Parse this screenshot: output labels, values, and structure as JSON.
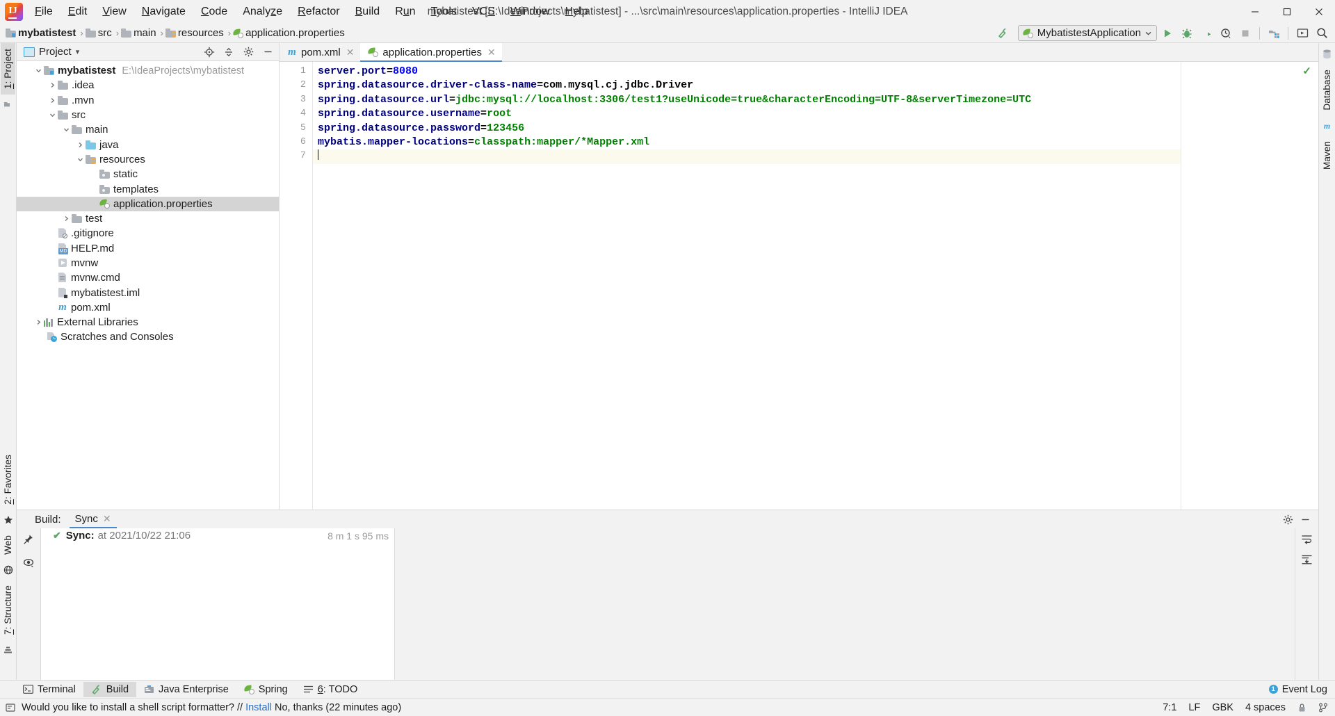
{
  "window": {
    "title": "mybatistest [E:\\IdeaProjects\\mybatistest] - ...\\src\\main\\resources\\application.properties - IntelliJ IDEA",
    "minimize_label": "—",
    "maximize_label": "❐",
    "close_label": "✕"
  },
  "menubar": {
    "items": [
      {
        "pre": "",
        "mn": "F",
        "post": "ile"
      },
      {
        "pre": "",
        "mn": "E",
        "post": "dit"
      },
      {
        "pre": "",
        "mn": "V",
        "post": "iew"
      },
      {
        "pre": "",
        "mn": "N",
        "post": "avigate"
      },
      {
        "pre": "",
        "mn": "C",
        "post": "ode"
      },
      {
        "pre": "Analy",
        "mn": "z",
        "post": "e"
      },
      {
        "pre": "",
        "mn": "R",
        "post": "efactor"
      },
      {
        "pre": "",
        "mn": "B",
        "post": "uild"
      },
      {
        "pre": "R",
        "mn": "u",
        "post": "n"
      },
      {
        "pre": "",
        "mn": "T",
        "post": "ools"
      },
      {
        "pre": "VC",
        "mn": "S",
        "post": ""
      },
      {
        "pre": "",
        "mn": "W",
        "post": "indow"
      },
      {
        "pre": "",
        "mn": "H",
        "post": "elp"
      }
    ]
  },
  "navbar": {
    "breadcrumbs": [
      {
        "label": "mybatistest",
        "icon": "module-folder-icon",
        "bold": true
      },
      {
        "label": "src",
        "icon": "folder-icon",
        "bold": false
      },
      {
        "label": "main",
        "icon": "folder-icon",
        "bold": false
      },
      {
        "label": "resources",
        "icon": "resources-folder-icon",
        "bold": false
      },
      {
        "label": "application.properties",
        "icon": "spring-properties-icon",
        "bold": false
      }
    ],
    "separator": "›",
    "run_config": {
      "label": "MybatistestApplication",
      "chevron": "⌄"
    },
    "buttons": [
      {
        "name": "build-hammer-icon"
      },
      {
        "name": "run-icon"
      },
      {
        "name": "debug-icon"
      },
      {
        "name": "run-with-coverage-icon"
      },
      {
        "name": "profile-icon"
      },
      {
        "name": "stop-icon"
      },
      {
        "name": "project-structure-icon"
      },
      {
        "name": "updates-icon"
      },
      {
        "name": "search-everywhere-icon"
      }
    ]
  },
  "left_rail": {
    "tabs": [
      {
        "num": "1",
        "label": "Project"
      }
    ],
    "icons": [
      "structure-icon"
    ]
  },
  "left_rail_bottom": {
    "tabs": [
      {
        "num": "2",
        "label": "Favorites"
      },
      {
        "num": "7",
        "label": "Structure"
      }
    ],
    "web_label": "Web",
    "icons": [
      "star-icon",
      "web-icon",
      "ant-icon"
    ]
  },
  "right_rail": {
    "tabs": [
      {
        "label": "Database"
      },
      {
        "label": "Maven"
      }
    ]
  },
  "project_panel": {
    "title": "Project",
    "chevron": "▾",
    "actions": [
      "locate-icon",
      "collapse-all-icon",
      "settings-gear-icon",
      "hide-icon"
    ],
    "tree": [
      {
        "depth": 0,
        "arrow": "down",
        "icon": "module-folder-icon",
        "label": "mybatistest",
        "bold": true,
        "path": "E:\\IdeaProjects\\mybatistest",
        "selected": false
      },
      {
        "depth": 1,
        "arrow": "right",
        "icon": "folder-icon",
        "label": ".idea",
        "bold": false,
        "path": "",
        "selected": false
      },
      {
        "depth": 1,
        "arrow": "right",
        "icon": "folder-icon",
        "label": ".mvn",
        "bold": false,
        "path": "",
        "selected": false
      },
      {
        "depth": 1,
        "arrow": "down",
        "icon": "folder-icon",
        "label": "src",
        "bold": false,
        "path": "",
        "selected": false
      },
      {
        "depth": 2,
        "arrow": "down",
        "icon": "folder-icon",
        "label": "main",
        "bold": false,
        "path": "",
        "selected": false
      },
      {
        "depth": 3,
        "arrow": "right",
        "icon": "source-folder-icon",
        "label": "java",
        "bold": false,
        "path": "",
        "selected": false
      },
      {
        "depth": 3,
        "arrow": "down",
        "icon": "resources-folder-icon",
        "label": "resources",
        "bold": false,
        "path": "",
        "selected": false
      },
      {
        "depth": 4,
        "arrow": "none",
        "icon": "static-folder-icon",
        "label": "static",
        "bold": false,
        "path": "",
        "selected": false
      },
      {
        "depth": 4,
        "arrow": "none",
        "icon": "static-folder-icon",
        "label": "templates",
        "bold": false,
        "path": "",
        "selected": false
      },
      {
        "depth": 4,
        "arrow": "none",
        "icon": "spring-properties-icon",
        "label": "application.properties",
        "bold": false,
        "path": "",
        "selected": true
      },
      {
        "depth": 2,
        "arrow": "right",
        "icon": "folder-icon",
        "label": "test",
        "bold": false,
        "path": "",
        "selected": false
      },
      {
        "depth": 1,
        "arrow": "none",
        "icon": "gitignore-icon",
        "label": ".gitignore",
        "bold": false,
        "path": "",
        "selected": false
      },
      {
        "depth": 1,
        "arrow": "none",
        "icon": "markdown-icon",
        "label": "HELP.md",
        "bold": false,
        "path": "",
        "selected": false
      },
      {
        "depth": 1,
        "arrow": "none",
        "icon": "shell-script-icon",
        "label": "mvnw",
        "bold": false,
        "path": "",
        "selected": false
      },
      {
        "depth": 1,
        "arrow": "none",
        "icon": "text-file-icon",
        "label": "mvnw.cmd",
        "bold": false,
        "path": "",
        "selected": false
      },
      {
        "depth": 1,
        "arrow": "none",
        "icon": "iml-file-icon",
        "label": "mybatistest.iml",
        "bold": false,
        "path": "",
        "selected": false
      },
      {
        "depth": 1,
        "arrow": "none",
        "icon": "maven-pom-icon",
        "label": "pom.xml",
        "bold": false,
        "path": "",
        "selected": false
      },
      {
        "depth": 0,
        "arrow": "right",
        "icon": "external-libraries-icon",
        "label": "External Libraries",
        "bold": false,
        "path": "",
        "selected": false
      },
      {
        "depth": 0,
        "arrow": "none",
        "icon": "scratches-icon",
        "label": "Scratches and Consoles",
        "bold": false,
        "path": "",
        "selected": false
      }
    ]
  },
  "editor": {
    "tabs": [
      {
        "label": "pom.xml",
        "icon": "maven-pom-icon",
        "active": false,
        "close": "✕"
      },
      {
        "label": "application.properties",
        "icon": "spring-properties-icon",
        "active": true,
        "close": "✕"
      }
    ],
    "inspection_ok": "✓",
    "lines": [
      {
        "num": "1",
        "key": "server.port",
        "eq": "=",
        "value": "8080",
        "vtype": "num",
        "current": false
      },
      {
        "num": "2",
        "key": "spring.datasource.driver-class-name",
        "eq": "=",
        "value": "com.mysql.cj.jdbc.Driver",
        "vtype": "plain",
        "current": false
      },
      {
        "num": "3",
        "key": "spring.datasource.url",
        "eq": "=",
        "value": "jdbc:mysql://localhost:3306/test1?useUnicode=true&characterEncoding=UTF-8&serverTimezone=UTC",
        "vtype": "str",
        "current": false
      },
      {
        "num": "4",
        "key": "spring.datasource.username",
        "eq": "=",
        "value": "root",
        "vtype": "str",
        "current": false
      },
      {
        "num": "5",
        "key": "spring.datasource.password",
        "eq": "=",
        "value": "123456",
        "vtype": "str",
        "current": false
      },
      {
        "num": "6",
        "key": "mybatis.mapper-locations",
        "eq": "=",
        "value": "classpath:mapper/*Mapper.xml",
        "vtype": "str",
        "current": false
      },
      {
        "num": "7",
        "key": "",
        "eq": "",
        "value": "",
        "vtype": "str",
        "current": true
      }
    ]
  },
  "build_panel": {
    "title": "Build:",
    "tab": {
      "label": "Sync",
      "close": "✕"
    },
    "actions": [
      "settings-gear-icon",
      "hide-icon"
    ],
    "rail_icons": [
      "pin-icon",
      "eye-icon"
    ],
    "right_rail_icons": [
      "soft-wrap-icon",
      "scroll-to-end-icon"
    ],
    "rows": [
      {
        "check": "✔",
        "status": "Sync:",
        "at": "at 2021/10/22 21:06",
        "duration": "8 m 1 s 95 ms"
      }
    ]
  },
  "toolwindow_bar": {
    "items": [
      {
        "label": "Terminal",
        "mn": "",
        "icon": "terminal-icon",
        "selected": false,
        "num": ""
      },
      {
        "label": "Build",
        "mn": "",
        "icon": "build-hammer-icon",
        "selected": true,
        "num": ""
      },
      {
        "label": "Java Enterprise",
        "mn": "",
        "icon": "java-enterprise-icon",
        "selected": false,
        "num": ""
      },
      {
        "label": "Spring",
        "mn": "",
        "icon": "spring-leaf-icon",
        "selected": false,
        "num": ""
      },
      {
        "label": "TODO",
        "mn": "6",
        "icon": "todo-icon",
        "selected": false,
        "num": "6"
      }
    ],
    "event_log": {
      "label": "Event Log",
      "badge": "1"
    }
  },
  "statusbar": {
    "message_prefix": "Would you like to install a shell script formatter? //",
    "message_link": "Install",
    "message_suffix": "No, thanks (22 minutes ago)",
    "position": "7:1",
    "line_sep": "LF",
    "encoding": "GBK",
    "indent": "4 spaces",
    "lock_icon": "lock-icon",
    "branch_icon": "git-branch-icon"
  },
  "colors": {
    "accent_blue": "#4a88c7",
    "key_navy": "#000080",
    "value_green": "#008000",
    "number_blue": "#0000ff",
    "spring_green": "#6db33f",
    "selection_gray": "#d4d4d4",
    "panel_bg": "#f2f2f2"
  }
}
